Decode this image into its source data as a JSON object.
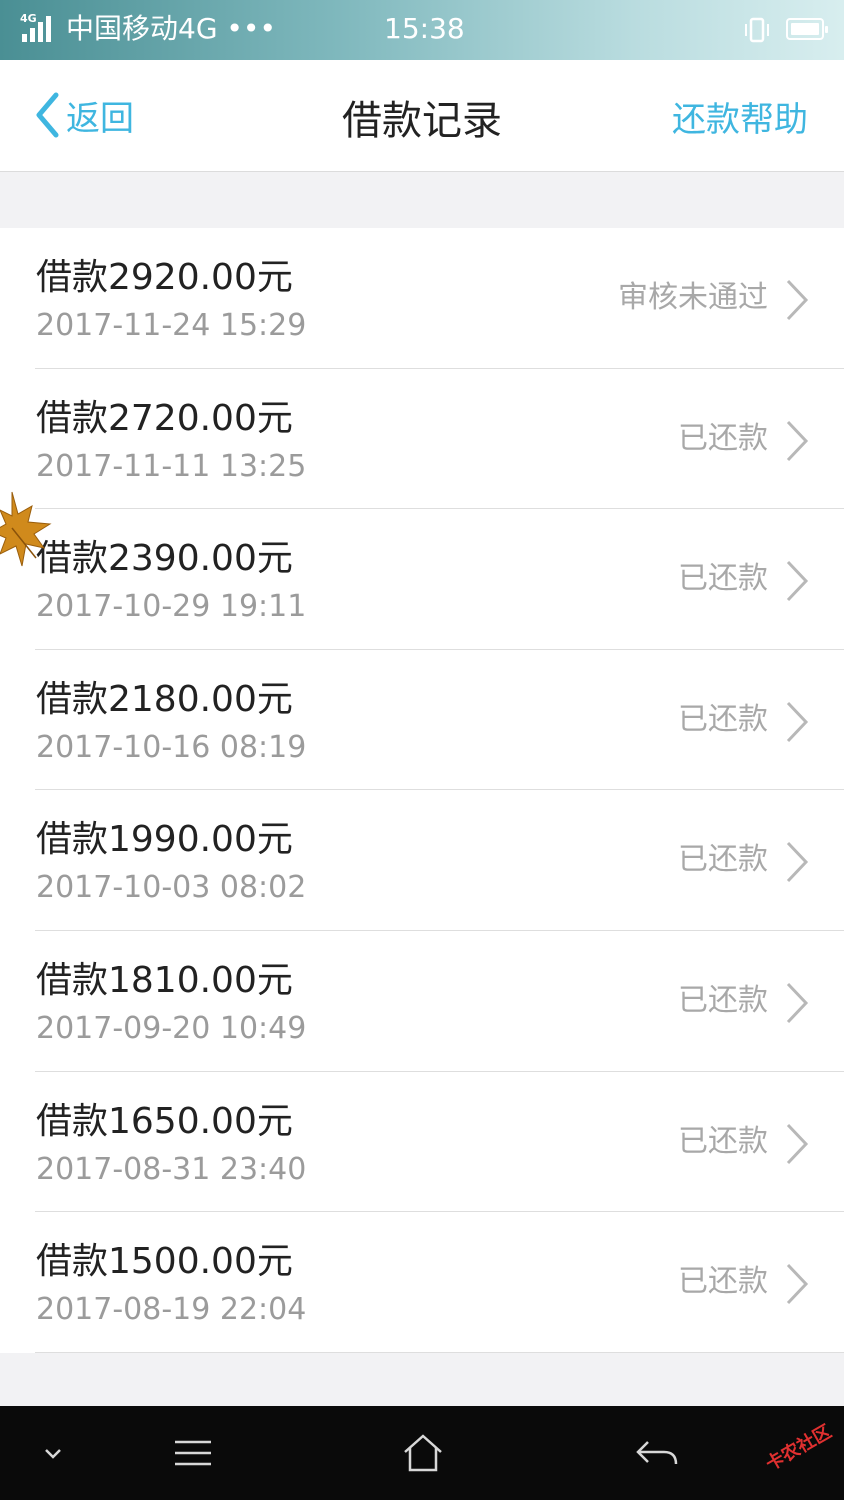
{
  "status_bar": {
    "network": "4G",
    "carrier": "中国移动4G •••",
    "time": "15:38"
  },
  "nav": {
    "back_label": "返回",
    "title": "借款记录",
    "help_label": "还款帮助"
  },
  "colors": {
    "accent": "#3fb6e0",
    "status_text": "#a8a8a8",
    "primary_text": "#222222",
    "secondary_text": "#9b9b9b"
  },
  "loans": [
    {
      "amount": "借款2920.00元",
      "datetime": "2017-11-24 15:29",
      "status": "审核未通过"
    },
    {
      "amount": "借款2720.00元",
      "datetime": "2017-11-11 13:25",
      "status": "已还款"
    },
    {
      "amount": "借款2390.00元",
      "datetime": "2017-10-29 19:11",
      "status": "已还款"
    },
    {
      "amount": "借款2180.00元",
      "datetime": "2017-10-16 08:19",
      "status": "已还款"
    },
    {
      "amount": "借款1990.00元",
      "datetime": "2017-10-03 08:02",
      "status": "已还款"
    },
    {
      "amount": "借款1810.00元",
      "datetime": "2017-09-20 10:49",
      "status": "已还款"
    },
    {
      "amount": "借款1650.00元",
      "datetime": "2017-08-31 23:40",
      "status": "已还款"
    },
    {
      "amount": "借款1500.00元",
      "datetime": "2017-08-19 22:04",
      "status": "已还款"
    }
  ],
  "bottom_nav": {
    "icons": [
      "chevron-down-icon",
      "menu-icon",
      "home-icon",
      "back-arrow-icon"
    ]
  },
  "watermark": "卡农社区"
}
